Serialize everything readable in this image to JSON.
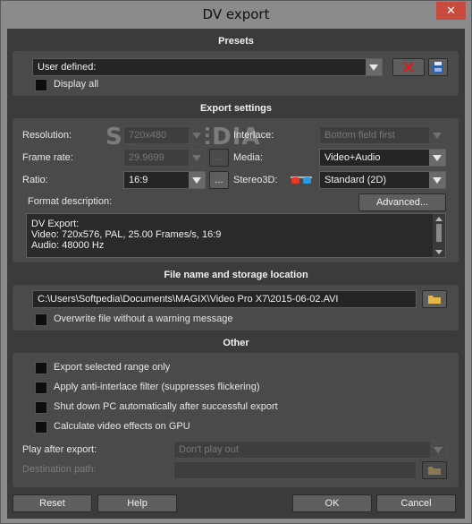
{
  "window": {
    "title": "DV export",
    "close_glyph": "✕"
  },
  "presets": {
    "header": "Presets",
    "preset_value": "User defined:",
    "display_all_label": "Display all"
  },
  "export_settings": {
    "header": "Export settings",
    "resolution_label": "Resolution:",
    "resolution_value": "720x480",
    "frame_rate_label": "Frame rate:",
    "frame_rate_value": "29.9699",
    "ratio_label": "Ratio:",
    "ratio_value": "16:9",
    "ellipsis": "...",
    "interlace_label": "Interlace:",
    "interlace_value": "Bottom field first",
    "media_label": "Media:",
    "media_value": "Video+Audio",
    "stereo_label": "Stereo3D:",
    "stereo_value": "Standard (2D)",
    "format_desc_label": "Format description:",
    "advanced_label": "Advanced...",
    "description_lines": [
      "DV Export:",
      "Video: 720x576, PAL, 25.00 Frames/s, 16:9",
      "Audio: 48000 Hz"
    ]
  },
  "file": {
    "header": "File name and storage location",
    "path": "C:\\Users\\Softpedia\\Documents\\MAGIX\\Video Pro X7\\2015-06-02.AVI",
    "overwrite_label": "Overwrite file without a warning message"
  },
  "other": {
    "header": "Other",
    "options": [
      "Export selected range only",
      "Apply anti-interlace filter (suppresses flickering)",
      "Shut down PC automatically after successful export",
      "Calculate video effects on GPU"
    ],
    "play_after_label": "Play after export:",
    "play_after_value": "Don't play out",
    "destination_label": "Destination path:"
  },
  "footer": {
    "reset": "Reset",
    "help": "Help",
    "ok": "OK",
    "cancel": "Cancel"
  },
  "watermark": "SOFTPEDIA",
  "colors": {
    "delete_icon": "#d21f1f",
    "save_icon": "#2a5fb8",
    "folder_icon": "#e6b84a"
  }
}
